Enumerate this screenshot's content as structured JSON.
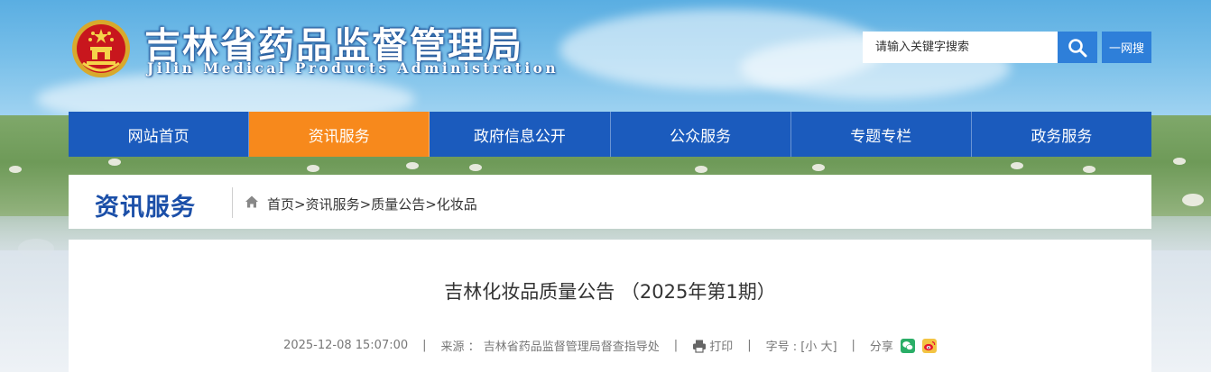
{
  "header": {
    "title": "吉林省药品监督管理局",
    "subtitle": "Jilin Medical Products Administration",
    "emblem_icon": "national-emblem-icon",
    "search": {
      "placeholder": "请输入关键字搜索",
      "value": "",
      "button_icon": "search-icon",
      "yiwang_label": "一网搜"
    }
  },
  "nav": {
    "items": [
      {
        "label": "网站首页"
      },
      {
        "label": "资讯服务",
        "active": true
      },
      {
        "label": "政府信息公开"
      },
      {
        "label": "公众服务"
      },
      {
        "label": "专题专栏"
      },
      {
        "label": "政务服务"
      }
    ]
  },
  "breadcrumb": {
    "section_title": "资讯服务",
    "home_icon": "home-icon",
    "items": [
      "首页",
      ">",
      "资讯服务",
      ">",
      "质量公告",
      ">",
      "化妆品"
    ]
  },
  "article": {
    "title": "吉林化妆品质量公告 （2025年第1期）",
    "meta": {
      "datetime": "2025-12-08 15:07:00",
      "source_label": "来源 ： 吉林省药品监督管理局督查指导处",
      "print_label": "打印",
      "font_size_label": "字号 : [小 大]",
      "share_label": "分享",
      "separator": "|",
      "wechat_icon": "wechat-icon",
      "weibo_icon": "weibo-icon"
    }
  },
  "colors": {
    "nav_bg": "#1b5bbd",
    "nav_active": "#f7891c",
    "search_button": "#2e7fd9",
    "section_title": "#1b4fa8"
  }
}
